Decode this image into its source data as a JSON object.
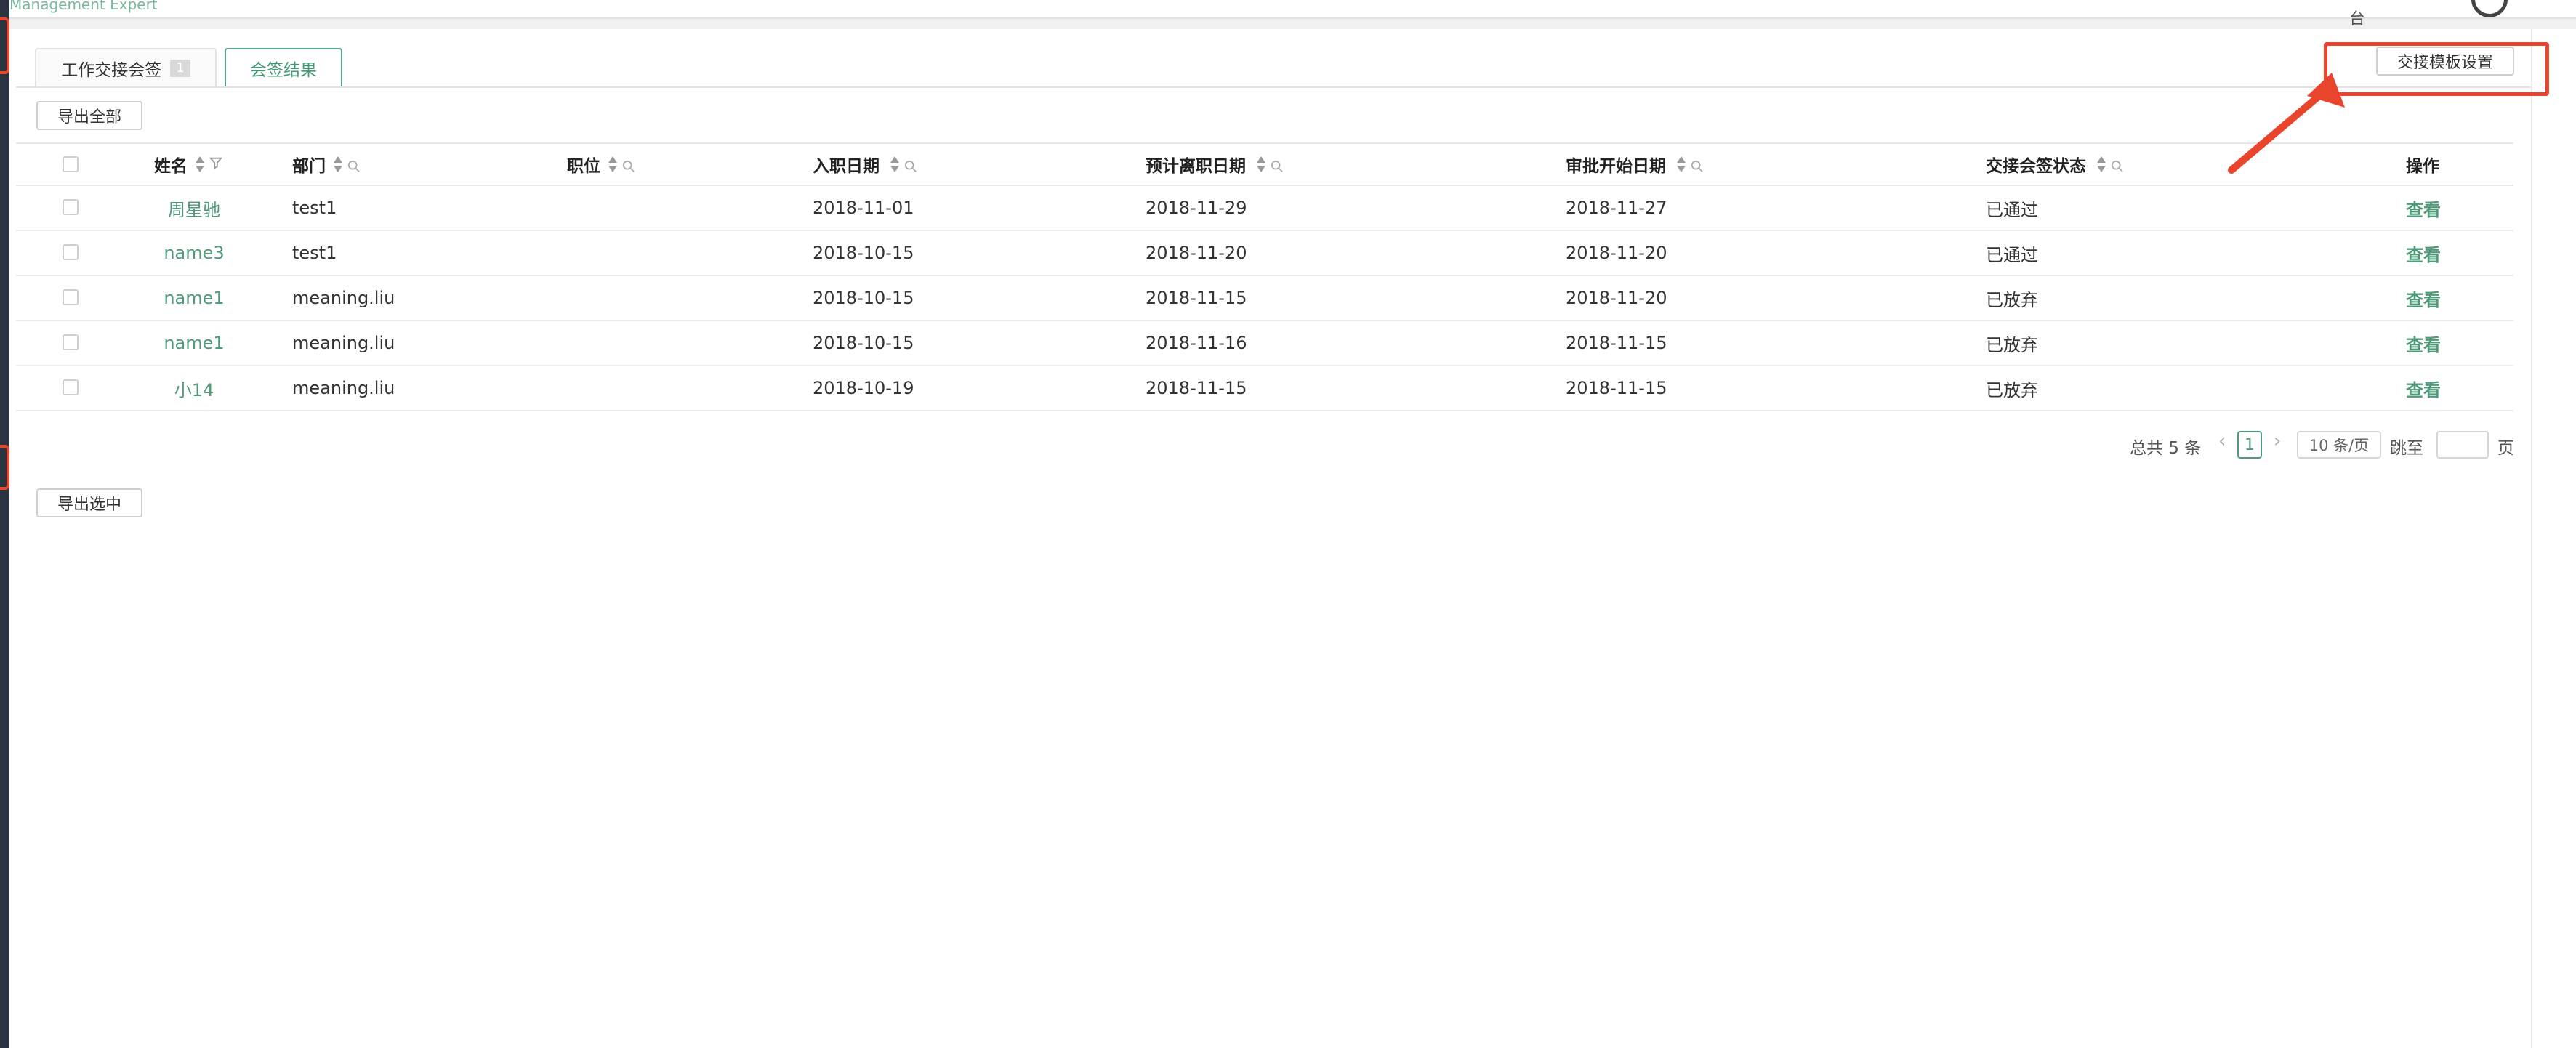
{
  "header": {
    "brand": "Management Expert",
    "right_text": "台"
  },
  "tabs": [
    {
      "label": "工作交接会签",
      "count": "1"
    },
    {
      "label": "会签结果"
    }
  ],
  "buttons": {
    "template_settings": "交接模板设置",
    "export_all": "导出全部",
    "export_selected": "导出选中"
  },
  "table": {
    "columns": [
      "姓名",
      "部门",
      "职位",
      "入职日期",
      "预计离职日期",
      "审批开始日期",
      "交接会签状态",
      "操作"
    ],
    "rows": [
      {
        "name": "周星驰",
        "dept": "test1",
        "position": "",
        "join": "2018-11-01",
        "leave": "2018-11-29",
        "approve": "2018-11-27",
        "status": "已通过",
        "action": "查看"
      },
      {
        "name": "name3",
        "dept": "test1",
        "position": "",
        "join": "2018-10-15",
        "leave": "2018-11-20",
        "approve": "2018-11-20",
        "status": "已通过",
        "action": "查看"
      },
      {
        "name": "name1",
        "dept": "meaning.liu",
        "position": "",
        "join": "2018-10-15",
        "leave": "2018-11-15",
        "approve": "2018-11-20",
        "status": "已放弃",
        "action": "查看"
      },
      {
        "name": "name1",
        "dept": "meaning.liu",
        "position": "",
        "join": "2018-10-15",
        "leave": "2018-11-16",
        "approve": "2018-11-15",
        "status": "已放弃",
        "action": "查看"
      },
      {
        "name": "小14",
        "dept": "meaning.liu",
        "position": "",
        "join": "2018-10-19",
        "leave": "2018-11-15",
        "approve": "2018-11-15",
        "status": "已放弃",
        "action": "查看"
      }
    ]
  },
  "pagination": {
    "total": "总共 5 条",
    "current_page": "1",
    "page_size": "10 条/页",
    "jump_label": "跳至",
    "page_unit": "页"
  },
  "colors": {
    "accent": "#4f9a78",
    "annotation": "#e8452c",
    "sidebar": "#2b3340"
  }
}
